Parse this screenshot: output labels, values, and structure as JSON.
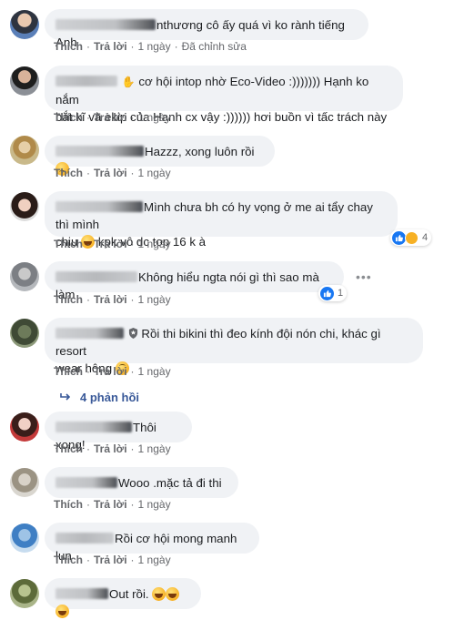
{
  "actions": {
    "like": "Thích",
    "reply": "Trả lời",
    "time": "1 ngày",
    "edited": "Đã chỉnh sửa"
  },
  "comments": [
    {
      "text": "nthương cô ấy quá vì ko rành tiếng Anh",
      "edited": true
    },
    {
      "line1": "cơ hội intop nhờ Eco-Video :))))))) Hạnh ko nắm",
      "line2": "bắt kĩ và ekip của Hạnh cx vậy :)))))) hơi buồn vì tấc trách này"
    },
    {
      "text": "Hazzz, xong luôn rồi"
    },
    {
      "line1": "Mình chưa bh có hy vọng ở me ai tẩy chay thì mình",
      "line2": "kpk vô dc top 16 k à",
      "line2_prefix": "chịu",
      "reactions": "4"
    },
    {
      "text": "Không hiểu ngta nói gì thì sao mà làm",
      "reactions": "1",
      "more": "•••"
    },
    {
      "line1": "Rồi thi bikini thì đeo kính đội nón chi, khác gì resort",
      "line2": "wear hông"
    },
    {
      "text": "Thôi xong!"
    },
    {
      "text": "Wooo .mặc tả đi thi"
    },
    {
      "text": "Rồi cơ hội mong manh lun"
    },
    {
      "text": "Out rồi."
    }
  ],
  "replies": {
    "label": "4 phản hồi"
  },
  "colors": {
    "bubble": "#f0f2f5",
    "link": "#385898",
    "meta": "#65676b",
    "like_blue": "#1877f2"
  }
}
